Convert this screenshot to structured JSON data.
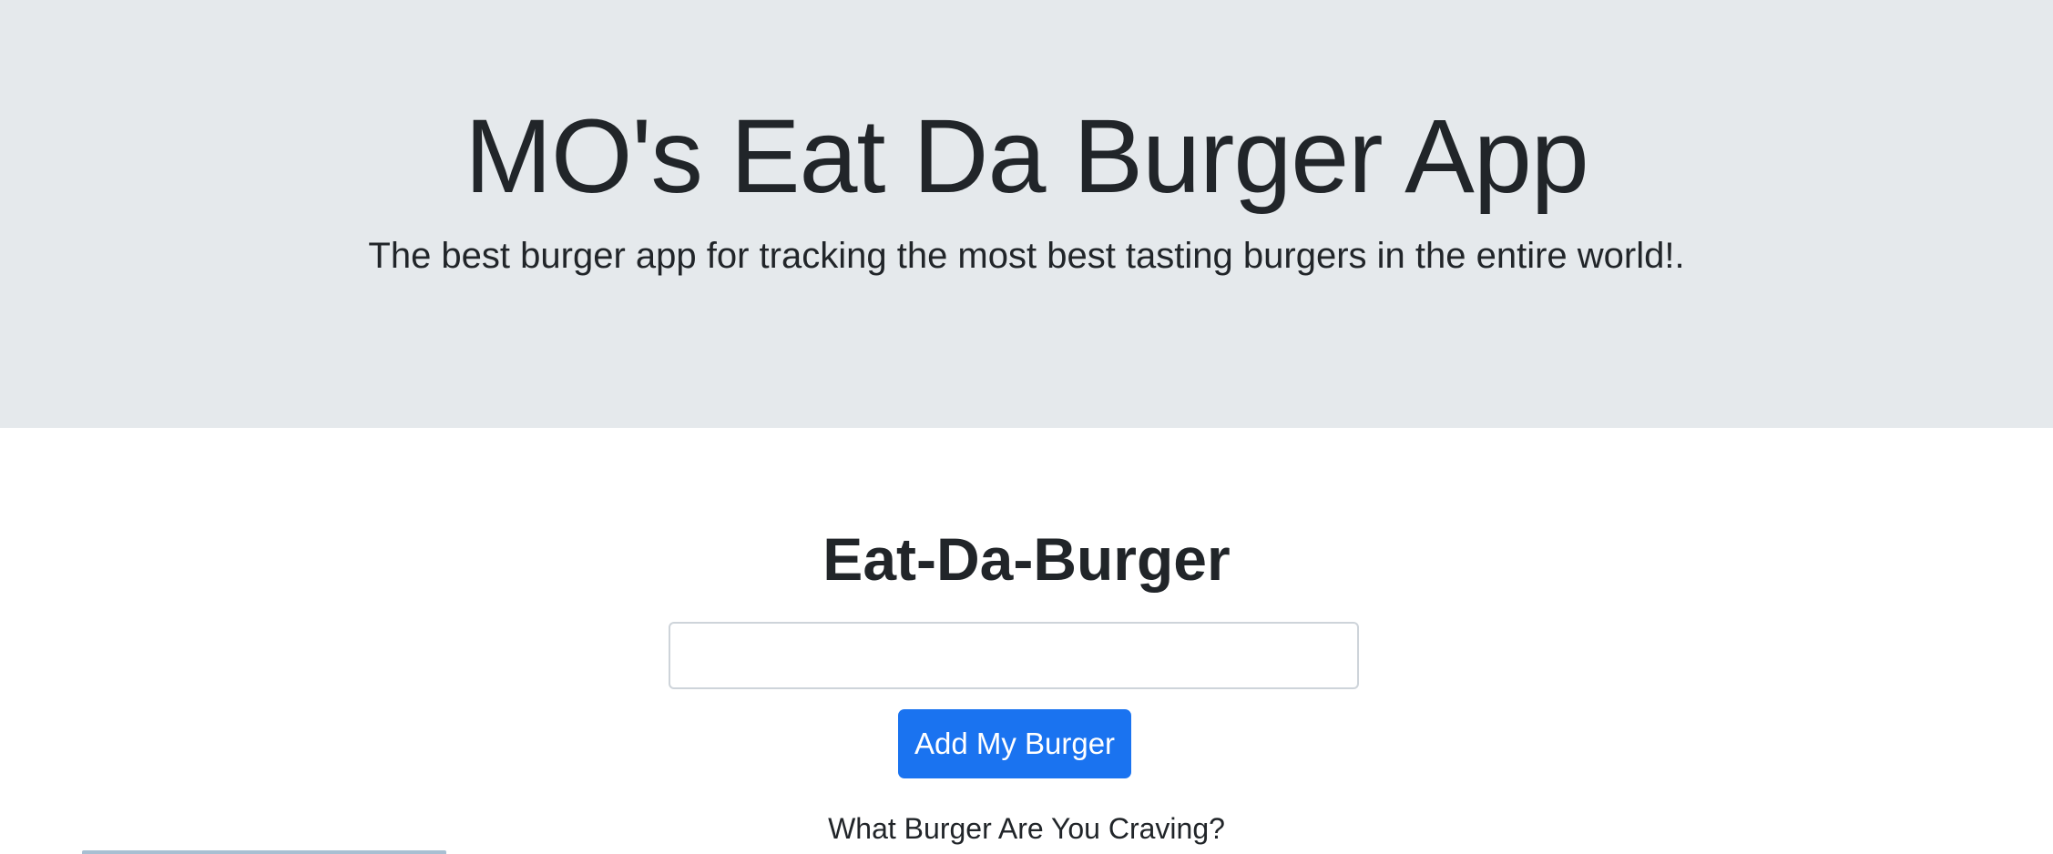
{
  "header": {
    "title": "MO's Eat Da Burger App",
    "lead": "The best burger app for tracking the most best tasting burgers in the entire world!."
  },
  "form": {
    "heading": "Eat-Da-Burger",
    "input_value": "",
    "input_placeholder": "",
    "submit_label": "Add My Burger",
    "prompt": "What Burger Are You Craving?"
  },
  "colors": {
    "jumbotron_bg": "#e5e9ec",
    "primary_button": "#1a73f0",
    "text": "#212529",
    "card_edge": "#a8bfd2"
  }
}
